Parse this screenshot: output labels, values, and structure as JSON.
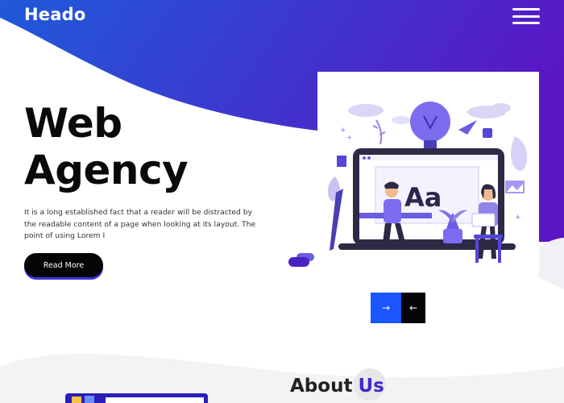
{
  "brand": {
    "logo": "Heado"
  },
  "nav": {
    "menu_icon": "hamburger-menu-icon"
  },
  "hero": {
    "title_line1": "Web",
    "title_line2": "Agency",
    "paragraph": "It is a long established fact that a reader will be distracted by the readable content of a page when looking at its layout. The point of using Lorem I",
    "button_label": "Read More",
    "illustration_text": "Aa"
  },
  "slider": {
    "next_label": "→",
    "prev_label": "←"
  },
  "about": {
    "heading_word": "About",
    "heading_accent": "Us"
  },
  "colors": {
    "gradient_start": "#1f5ad9",
    "gradient_end": "#5a16c4",
    "accent": "#4428c9",
    "button_bg": "#050505",
    "next_button": "#1a55ff"
  }
}
